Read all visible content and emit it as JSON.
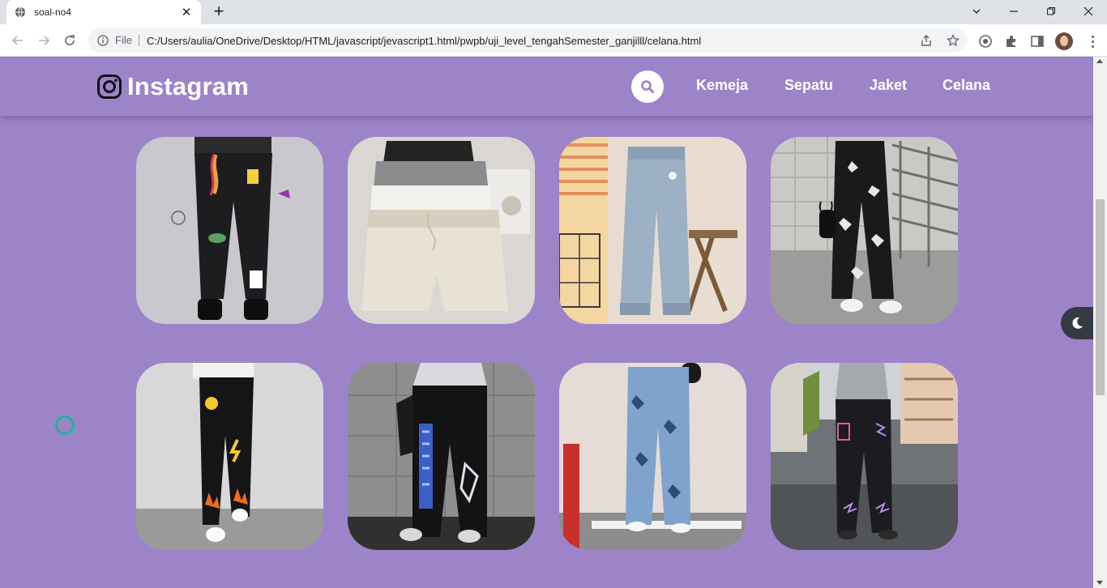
{
  "browser": {
    "tab_title": "soal-no4",
    "new_tab_symbol": "+",
    "omnibox_scheme": "File",
    "url": "C:/Users/aulia/OneDrive/Desktop/HTML/javascript/jevascript1.html/pwpb/uji_level_tengahSemester_ganjilll/celana.html"
  },
  "site": {
    "brand": "Instagram",
    "nav": [
      "Kemeja",
      "Sepatu",
      "Jaket",
      "Celana"
    ]
  },
  "colors": {
    "page_bg": "#9d84c9",
    "moon_button": "#333a44",
    "loader": "#20b2a0"
  },
  "gallery": [
    {
      "icon": "pants-product-image"
    },
    {
      "icon": "shorts-product-image"
    },
    {
      "icon": "jeans-product-image"
    },
    {
      "icon": "butterfly-pants-product-image"
    },
    {
      "icon": "smiley-pants-product-image"
    },
    {
      "icon": "graffiti-pants-product-image"
    },
    {
      "icon": "butterfly-jeans-product-image"
    },
    {
      "icon": "street-pants-product-image"
    }
  ]
}
